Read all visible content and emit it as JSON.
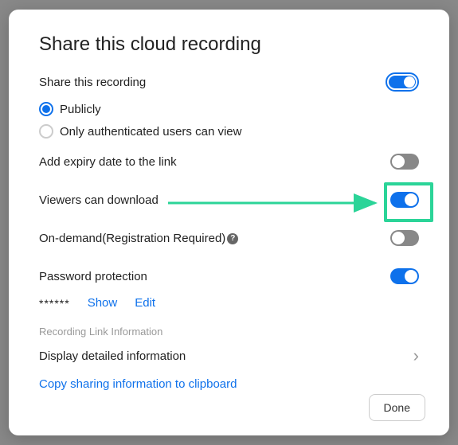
{
  "title": "Share this cloud recording",
  "shareRecording": {
    "label": "Share this recording",
    "options": {
      "publicly": "Publicly",
      "authenticated": "Only authenticated users can view"
    }
  },
  "expiry": {
    "label": "Add expiry date to the link"
  },
  "download": {
    "label": "Viewers can download"
  },
  "onDemand": {
    "label": "On-demand(Registration Required)",
    "helpIcon": "?"
  },
  "password": {
    "label": "Password protection",
    "masked": "******",
    "show": "Show",
    "edit": "Edit"
  },
  "linkInfo": {
    "section": "Recording Link Information",
    "display": "Display detailed information",
    "copy": "Copy sharing information to clipboard"
  },
  "doneButton": "Done"
}
